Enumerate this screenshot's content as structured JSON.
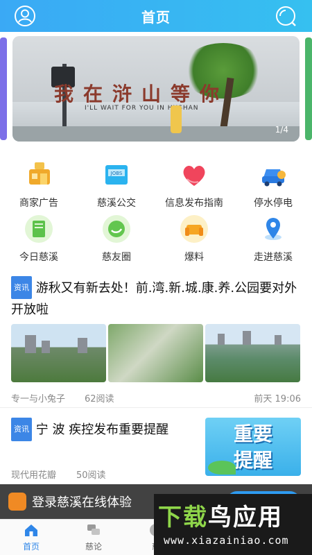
{
  "header": {
    "title": "首页",
    "profile_icon": "user-icon",
    "search_icon": "search-icon"
  },
  "banner": {
    "sign_text": "我在浒山等你",
    "sign_subtext": "I'LL WAIT FOR YOU IN HUSHAN",
    "pager": "1/4"
  },
  "menu": [
    {
      "label": "商家广告",
      "icon": "shop-ad-icon"
    },
    {
      "label": "慈溪公交",
      "icon": "bus-icon"
    },
    {
      "label": "信息发布指南",
      "icon": "heart-icon"
    },
    {
      "label": "停水停电",
      "icon": "car-icon"
    },
    {
      "label": "今日慈溪",
      "icon": "book-icon"
    },
    {
      "label": "慈友圈",
      "icon": "chat-icon"
    },
    {
      "label": "爆料",
      "icon": "sofa-icon"
    },
    {
      "label": "走进慈溪",
      "icon": "location-icon"
    }
  ],
  "news": [
    {
      "tag": "资讯",
      "title": "游秋又有新去处！前.湾.新.城.康.养.公园要对外开放啦",
      "author": "专一与小兔子",
      "reads": "62阅读",
      "time": "前天 19:06"
    },
    {
      "tag": "资讯",
      "title": "宁 波 疾控发布重要提醒",
      "author": "现代用花瓣",
      "reads": "50阅读",
      "image_line1": "重要",
      "image_line2": "提醒"
    }
  ],
  "login_bar": {
    "text": "登录慈溪在线体验",
    "button": ""
  },
  "tabs": [
    {
      "label": "首页",
      "icon": "home-icon",
      "active": true
    },
    {
      "label": "慈论",
      "icon": "discuss-icon",
      "active": false
    },
    {
      "label": "慈",
      "icon": "circle-icon",
      "active": false
    }
  ],
  "watermark": {
    "text_green": "下载",
    "text_white": "鸟应用",
    "url": "www.xiazainiao.com"
  },
  "colors": {
    "header": "#3aa9f5",
    "tag": "#3c86e6",
    "tab_active": "#2f86e8"
  }
}
